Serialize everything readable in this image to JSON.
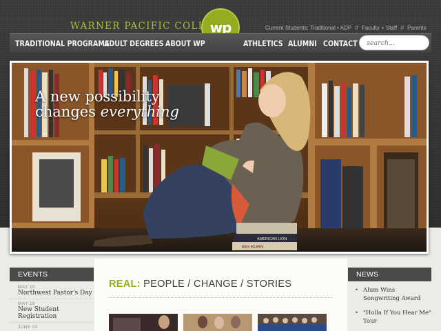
{
  "site": {
    "name": "WARNER PACIFIC COLLEGE",
    "logo_text": "wp"
  },
  "utility_links": [
    "Current Students: Traditional • ADP",
    "//",
    "Faculty + Staff",
    "//",
    "Parents"
  ],
  "nav": {
    "items": [
      "TRADITIONAL PROGRAMS",
      "ADULT DEGREES",
      "ABOUT WP",
      "ATHLETICS",
      "ALUMNI",
      "CONTACT"
    ]
  },
  "search": {
    "placeholder": "search..."
  },
  "hero": {
    "line1": "A new possibility",
    "line2_prefix": "changes ",
    "line2_emphasis": "everything",
    "book_titles": [
      "AMERICAN LION",
      "BIG BURN"
    ]
  },
  "events": {
    "heading": "EVENTS",
    "items": [
      {
        "date": "MAY 10",
        "title": "Northwest Pastor's Day"
      },
      {
        "date": "MAY 18",
        "title": "New Student Registration"
      },
      {
        "date": "JUNE 21",
        "title": ""
      }
    ]
  },
  "stories": {
    "accent": "REAL:",
    "title": " PEOPLE / CHANGE / STORIES"
  },
  "news": {
    "heading": "NEWS",
    "items": [
      "Alum Wins Songwriting Award",
      "\"Holla If You Hear Me\" Tour"
    ]
  },
  "colors": {
    "accent": "#93ad1f",
    "header_bg": "#333333",
    "nav_bg": "#4a4a4a"
  }
}
